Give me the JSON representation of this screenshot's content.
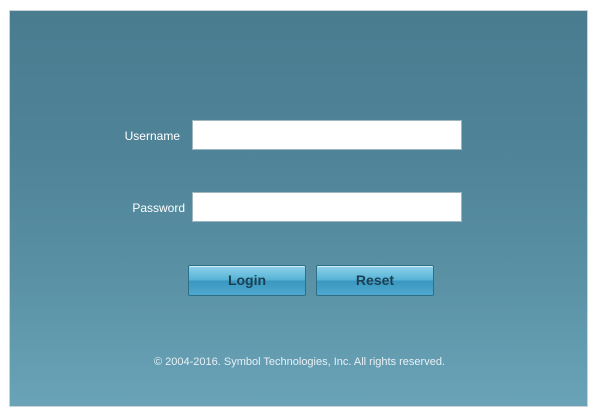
{
  "login_form": {
    "username_label": "Username",
    "username_value": "",
    "password_label": "Password",
    "password_value": "",
    "login_button": "Login",
    "reset_button": "Reset"
  },
  "footer": {
    "copyright": "© 2004-2016. Symbol Technologies, Inc. All rights reserved."
  }
}
